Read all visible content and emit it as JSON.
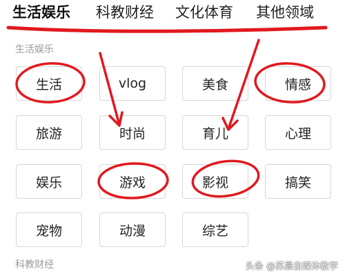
{
  "tabs": [
    {
      "label": "生活娱乐",
      "active": true
    },
    {
      "label": "科教财经",
      "active": false
    },
    {
      "label": "文化体育",
      "active": false
    },
    {
      "label": "其他领域",
      "active": false
    }
  ],
  "sections": [
    {
      "title": "生活娱乐",
      "items": [
        "生活",
        "vlog",
        "美食",
        "情感",
        "旅游",
        "时尚",
        "育儿",
        "心理",
        "娱乐",
        "游戏",
        "影视",
        "搞笑",
        "宠物",
        "动漫",
        "综艺"
      ]
    },
    {
      "title": "科教财经"
    }
  ],
  "annotations": {
    "color": "#e0191e",
    "circled_items": [
      "生活",
      "情感",
      "游戏",
      "影视"
    ]
  },
  "watermark": {
    "text": "头条 @苏晨自媒体教学"
  }
}
